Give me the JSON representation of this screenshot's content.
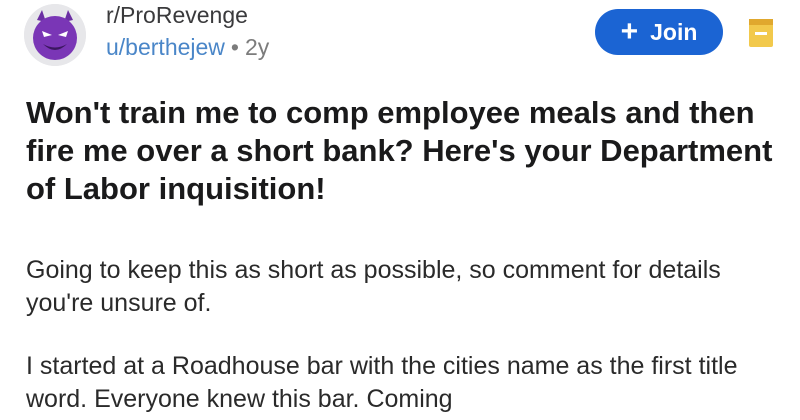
{
  "post": {
    "subreddit": "r/ProRevenge",
    "username": "u/berthejew",
    "separator": "•",
    "age": "2y",
    "join_icon": "+",
    "join_label": "Join",
    "save_icon": "bookmark-icon",
    "title": "Won't train me to comp employee meals and then fire me over a short bank? Here's your Department of Labor inquisition!",
    "paragraphs": [
      "Going to keep this as short as possible, so comment for details you're unsure of.",
      "I started at a Roadhouse bar with the cities  name as the first title word. Everyone knew this bar. Coming"
    ]
  },
  "colors": {
    "join_bg": "#1b64d3",
    "username": "#4a86c8",
    "save_icon": "#f2c94c",
    "avatar_face": "#6b2fa3"
  }
}
